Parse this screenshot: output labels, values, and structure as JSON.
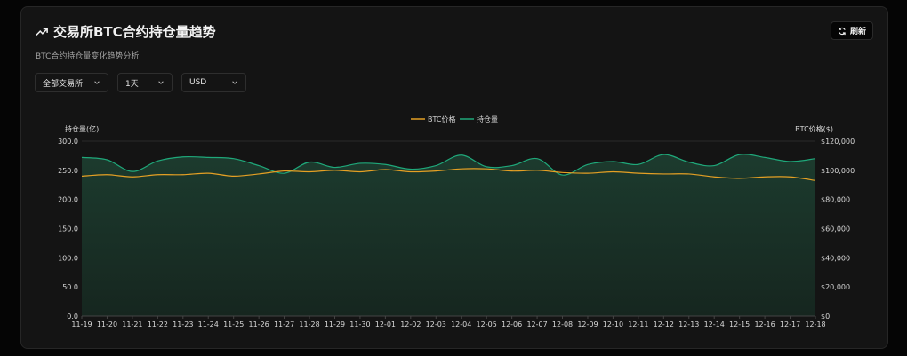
{
  "header": {
    "title": "交易所BTC合约持仓量趋势",
    "subtitle": "BTC合约持仓量变化趋势分析",
    "refresh_label": "刷新"
  },
  "filters": {
    "exchange": "全部交易所",
    "period": "1天",
    "currency": "USD"
  },
  "colors": {
    "price": "#e5a024",
    "oi": "#1fa87a",
    "oi_fill_top": "#1c3b2e",
    "oi_fill_bottom": "#16261f"
  },
  "chart_data": {
    "type": "line",
    "x": [
      "11-19",
      "11-20",
      "11-21",
      "11-22",
      "11-23",
      "11-24",
      "11-25",
      "11-26",
      "11-27",
      "11-28",
      "11-29",
      "11-30",
      "12-01",
      "12-02",
      "12-03",
      "12-04",
      "12-05",
      "12-06",
      "12-07",
      "12-08",
      "12-09",
      "12-10",
      "12-11",
      "12-12",
      "12-13",
      "12-14",
      "12-15",
      "12-16",
      "12-17",
      "12-18"
    ],
    "series": [
      {
        "name": "BTC价格",
        "axis": "right",
        "values": [
          96000,
          97000,
          95500,
          97000,
          97000,
          98000,
          96000,
          97500,
          99500,
          99000,
          100000,
          99000,
          100500,
          99000,
          99500,
          101000,
          101000,
          99500,
          100000,
          98500,
          98000,
          99000,
          98000,
          97500,
          97500,
          95500,
          94500,
          95500,
          95500,
          93000
        ]
      },
      {
        "name": "持仓量",
        "axis": "left",
        "values": [
          272,
          268,
          248,
          266,
          273,
          272,
          270,
          258,
          245,
          264,
          255,
          262,
          260,
          252,
          258,
          276,
          256,
          258,
          270,
          242,
          260,
          265,
          260,
          277,
          264,
          258,
          277,
          272,
          265,
          270
        ]
      }
    ],
    "ylabel": "持仓量(亿)",
    "y2label": "BTC价格($)",
    "ylim": [
      0,
      300
    ],
    "y2lim": [
      0,
      120000
    ],
    "yticks": [
      "0.0",
      "50.0",
      "100.0",
      "150.0",
      "200.0",
      "250.0",
      "300.0"
    ],
    "y2ticks": [
      "$0",
      "$20,000",
      "$40,000",
      "$60,000",
      "$80,000",
      "$100,000",
      "$120,000"
    ],
    "legend": "top-center",
    "grid": true
  }
}
